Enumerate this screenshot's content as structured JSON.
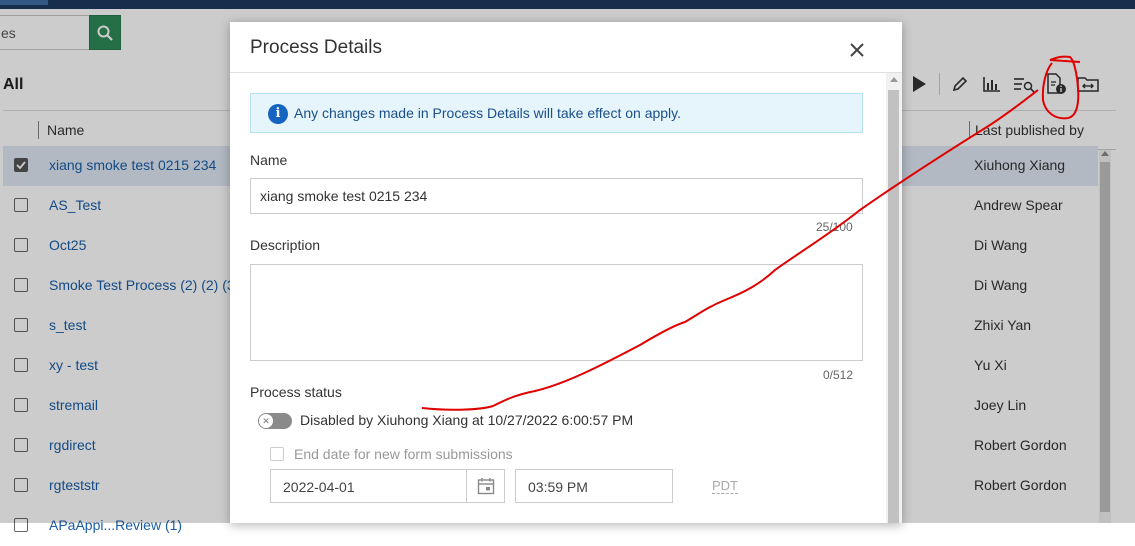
{
  "search": {
    "value": "es"
  },
  "filter": {
    "label": "All"
  },
  "grid": {
    "columns": {
      "name": "Name",
      "last_published_by": "Last published by"
    },
    "rows": [
      {
        "name": "xiang smoke test 0215 234",
        "publisher": "Xiuhong Xiang",
        "selected": true
      },
      {
        "name": "AS_Test",
        "publisher": "Andrew Spear"
      },
      {
        "name": "Oct25",
        "publisher": "Di Wang"
      },
      {
        "name": "Smoke Test Process (2) (2) (3",
        "publisher": "Di Wang"
      },
      {
        "name": "s_test",
        "publisher": "Zhixi Yan"
      },
      {
        "name": "xy - test",
        "publisher": "Yu Xi"
      },
      {
        "name": "stremail",
        "publisher": "Joey Lin"
      },
      {
        "name": "rgdirect",
        "publisher": "Robert Gordon"
      },
      {
        "name": "rgteststr",
        "publisher": "Robert Gordon"
      },
      {
        "name": "APaAppi...Review (1)",
        "publisher": ""
      }
    ]
  },
  "modal": {
    "title": "Process Details",
    "info": "Any changes made in Process Details will take effect on apply.",
    "name_label": "Name",
    "name_value": "xiang smoke test 0215 234",
    "name_counter": "25/100",
    "description_label": "Description",
    "description_value": "",
    "description_counter": "0/512",
    "status_label": "Process status",
    "status_text": "Disabled by Xiuhong Xiang at 10/27/2022 6:00:57 PM",
    "enddate_label": "End date for new form submissions",
    "date_value": "2022-04-01",
    "time_value": "03:59 PM",
    "timezone": "PDT"
  },
  "colors": {
    "accent": "#2e8b57",
    "link": "#1a5ea8",
    "annotation": "#e00000"
  }
}
